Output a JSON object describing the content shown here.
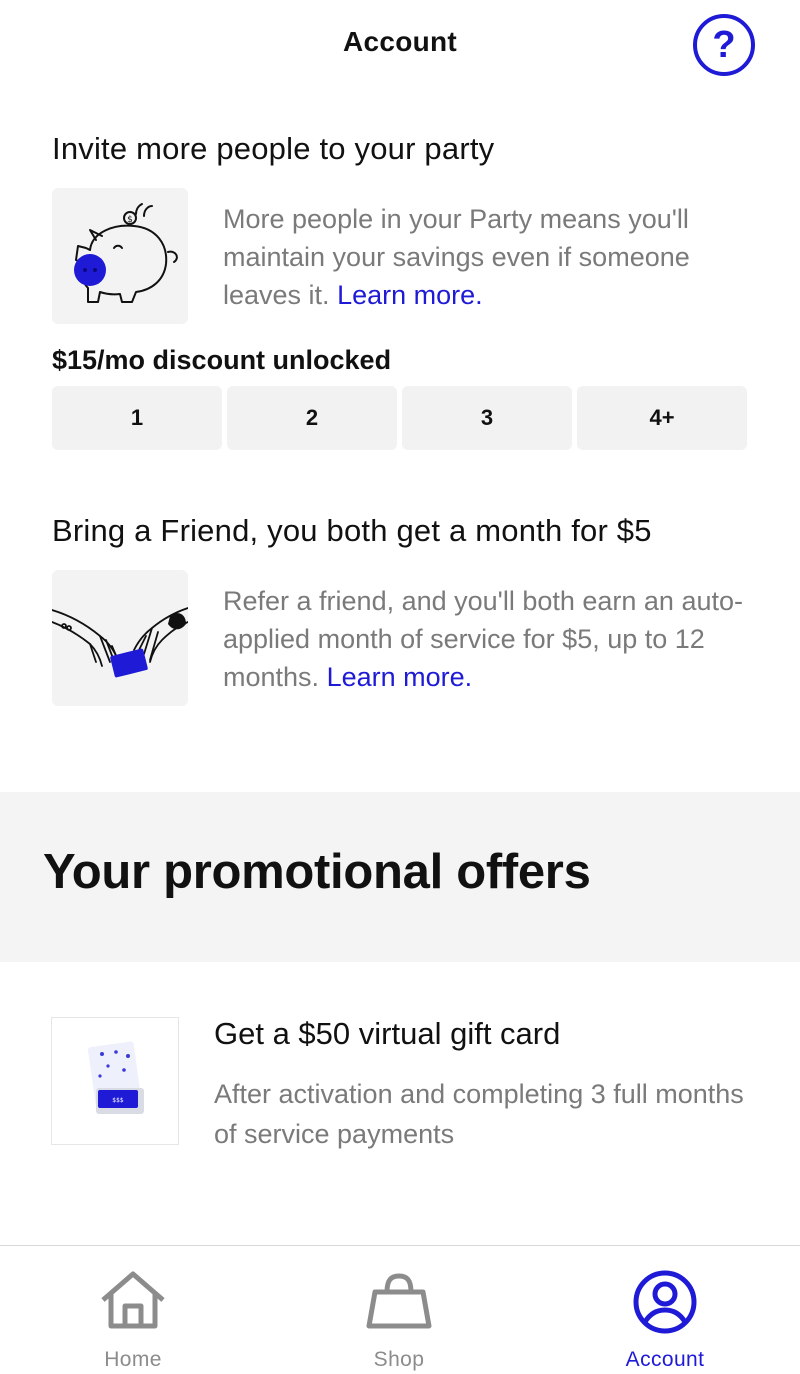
{
  "header": {
    "title": "Account",
    "help_icon": "question-circle-icon",
    "help_glyph": "?"
  },
  "invite": {
    "title": "Invite more people to your party",
    "image": "piggy-bank-icon",
    "description": "More people in your Party means you'll maintain your savings even if someone leaves it.",
    "link": "Learn more."
  },
  "party": {
    "discount_label": "$15/mo discount unlocked",
    "options": [
      "1",
      "2",
      "3",
      "4+"
    ]
  },
  "referral": {
    "title": "Bring a Friend, you both get a month for $5",
    "image": "hands-passing-card-icon",
    "description": "Refer a friend, and you'll both earn an auto-applied month of service for $5, up to 12 months.",
    "link": "Learn more."
  },
  "promotions": {
    "title": "Your promotional offers",
    "offers": [
      {
        "image": "gift-card-icon",
        "title": "Get a $50 virtual gift card",
        "description": "After activation and completing 3 full months of service payments"
      }
    ]
  },
  "nav": {
    "items": [
      {
        "label": "Home",
        "icon": "home-icon",
        "active": false
      },
      {
        "label": "Shop",
        "icon": "shopping-bag-icon",
        "active": false
      },
      {
        "label": "Account",
        "icon": "user-circle-icon",
        "active": true
      }
    ]
  },
  "colors": {
    "accent": "#1f1ad6",
    "muted_text": "#7a7a7a",
    "inactive_nav": "#8c8c8c",
    "panel_bg": "#f3f3f3"
  }
}
